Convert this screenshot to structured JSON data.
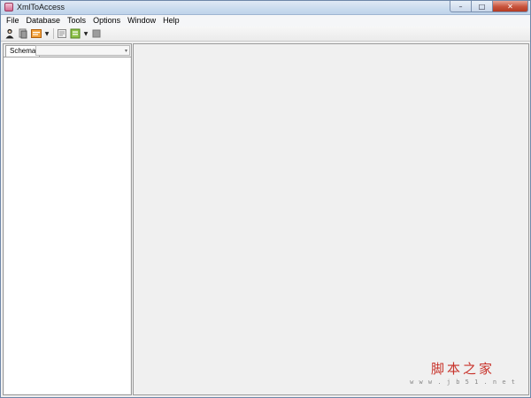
{
  "window": {
    "title": "XmlToAccess",
    "icon": "xml-to-access-app-icon"
  },
  "window_buttons": {
    "minimize": "–",
    "maximize": "□",
    "close": "✕"
  },
  "menu": [
    "File",
    "Database",
    "Tools",
    "Options",
    "Window",
    "Help"
  ],
  "toolbar": {
    "buttons": [
      "connect-user-icon",
      "open-document-icon",
      "open-xml-icon",
      "dropdown-arrow",
      "document-icon",
      "export-icon",
      "dropdown-arrow",
      "stop-icon"
    ]
  },
  "left_panel": {
    "tab_label": "Schema",
    "dropdown_value": ""
  },
  "watermark": {
    "text": "脚本之家",
    "url": "w w w . j b 5 1 . n e t"
  },
  "colors": {
    "title_bar": "#c9dbee",
    "close_button": "#c7533b",
    "background": "#f0f0f0",
    "watermark": "#c8342c"
  }
}
